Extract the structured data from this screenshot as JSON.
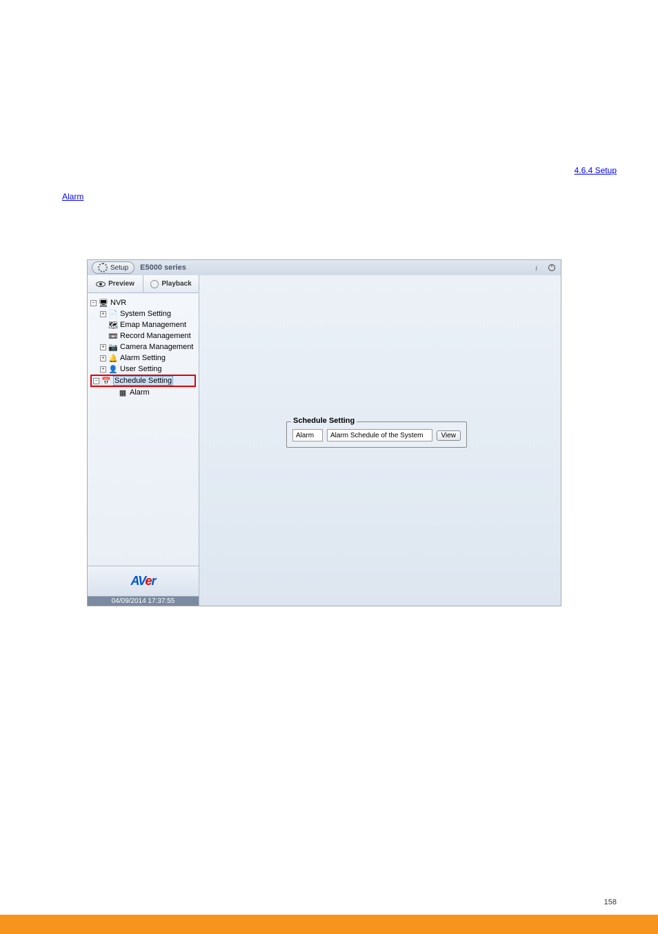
{
  "link_above": "4.6.4 Setup",
  "link_text_1": "Alarm",
  "page_number": "158",
  "window": {
    "setup_label": "Setup",
    "product_title": "E5000 series",
    "tabs": {
      "preview": "Preview",
      "playback": "Playback"
    },
    "tree": {
      "root": "NVR",
      "items": [
        "System Setting",
        "Emap Management",
        "Record Management",
        "Camera Management",
        "Alarm Setting",
        "User Setting",
        "Schedule Setting",
        "Alarm"
      ]
    },
    "logo": "AVer",
    "datetime": "04/09/2014 17:37:55",
    "schedule": {
      "legend": "Schedule Setting",
      "type": "Alarm",
      "desc": "Alarm Schedule of the System",
      "view_btn": "View"
    }
  }
}
